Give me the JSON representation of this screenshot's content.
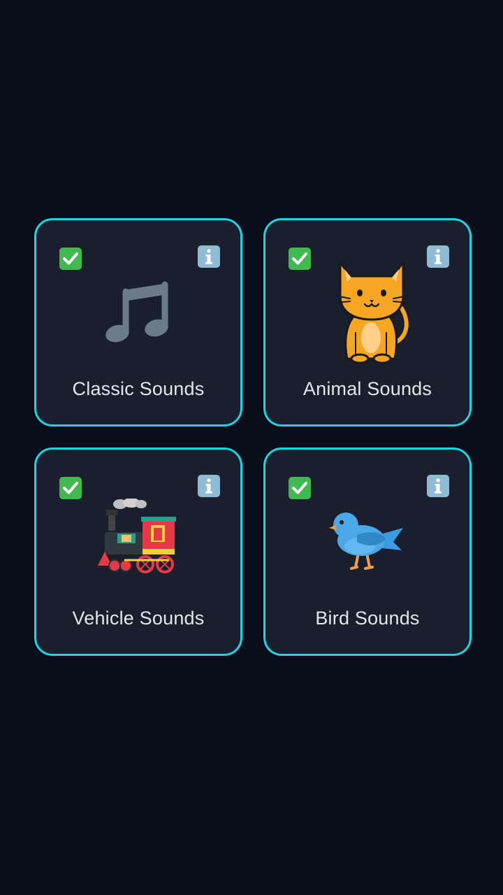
{
  "categories": [
    {
      "label": "Classic Sounds",
      "icon": "music-note-icon",
      "enabled": true
    },
    {
      "label": "Animal Sounds",
      "icon": "cat-icon",
      "enabled": true
    },
    {
      "label": "Vehicle Sounds",
      "icon": "locomotive-icon",
      "enabled": true
    },
    {
      "label": "Bird Sounds",
      "icon": "bird-icon",
      "enabled": true
    }
  ],
  "colors": {
    "background": "#090e1a",
    "card": "#1a1f2e",
    "card_border": "#19d6e0",
    "check": "#3fb950",
    "info": "#8fbcd4"
  }
}
